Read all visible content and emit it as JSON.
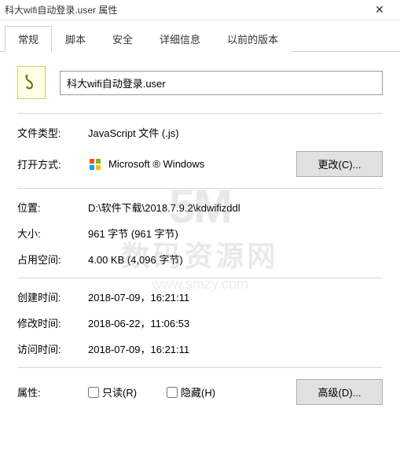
{
  "window": {
    "title": "科大wifi自动登录.user 属性",
    "close_glyph": "✕"
  },
  "tabs": [
    {
      "label": "常规",
      "active": true
    },
    {
      "label": "脚本",
      "active": false
    },
    {
      "label": "安全",
      "active": false
    },
    {
      "label": "详细信息",
      "active": false
    },
    {
      "label": "以前的版本",
      "active": false
    }
  ],
  "file": {
    "name": "科大wifi自动登录.user"
  },
  "props": {
    "filetype_label": "文件类型:",
    "filetype_value": "JavaScript 文件 (.js)",
    "openwith_label": "打开方式:",
    "openwith_app": "Microsoft ® Windows",
    "change_btn": "更改(C)...",
    "location_label": "位置:",
    "location_value": "D:\\软件下载\\2018.7.9.2\\kdwifizddl",
    "size_label": "大小:",
    "size_value": "961 字节 (961 字节)",
    "ondisk_label": "占用空间:",
    "ondisk_value": "4.00 KB (4,096 字节)",
    "created_label": "创建时间:",
    "created_value": "2018-07-09，16:21:11",
    "modified_label": "修改时间:",
    "modified_value": "2018-06-22，11:06:53",
    "accessed_label": "访问时间:",
    "accessed_value": "2018-07-09，16:21:11",
    "attr_label": "属性:",
    "readonly_label": "只读(R)",
    "hidden_label": "隐藏(H)",
    "advanced_btn": "高级(D)..."
  },
  "watermark": {
    "logo": "5M",
    "text": "数码资源网",
    "url": "www.smzy.com"
  }
}
